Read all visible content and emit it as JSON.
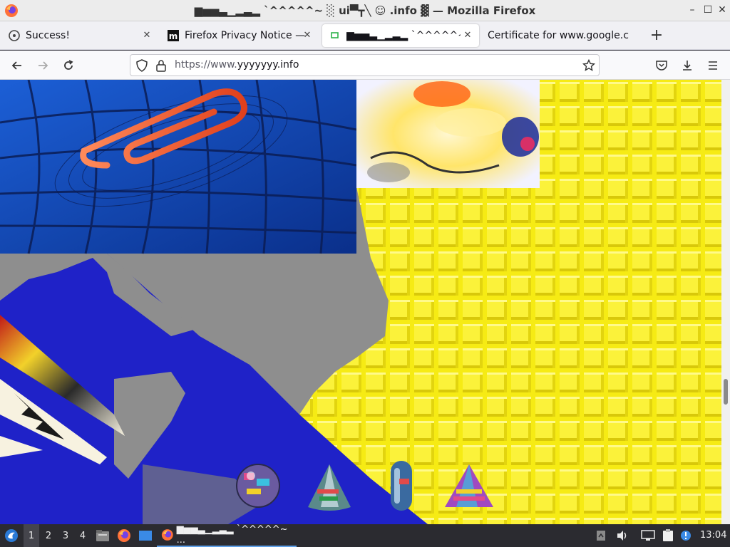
{
  "window": {
    "title": "▆▅▅▃▁▂▃▂ `^^^^^~ ░ ui▀┳╲ ☺ .info ▓ — Mozilla Firefox",
    "controls": [
      "–",
      "☐",
      "✕"
    ]
  },
  "tabs": [
    {
      "label": "Success!",
      "icon": "firefox-icon",
      "active": false
    },
    {
      "label": "Firefox Privacy Notice —",
      "icon": "mozilla-icon",
      "active": false
    },
    {
      "label": "▆▅▅▃▁▂▃▂ `^^^^^~ ░",
      "icon": "page-icon",
      "active": true
    },
    {
      "label": "Certificate for www.google.c",
      "icon": "",
      "active": false
    }
  ],
  "tab_close": "✕",
  "new_tab": "+",
  "navbar": {
    "url_prefix": "https://www.",
    "url_domain": "yyyyyyy.info"
  },
  "taskbar": {
    "workspaces": [
      "1",
      "2",
      "3",
      "4"
    ],
    "active_window": "▆▅▅▃▁▂▃▂ `^^^^^~ ...",
    "clock": "13:04"
  },
  "colors": {
    "page_yellow": "#f4e81a",
    "page_blue": "#1f22c8",
    "shadow_gray": "#8e8e8e",
    "titlebar": "#ececec",
    "taskbar": "#2b2b30",
    "accent": "#5fa0e8"
  }
}
